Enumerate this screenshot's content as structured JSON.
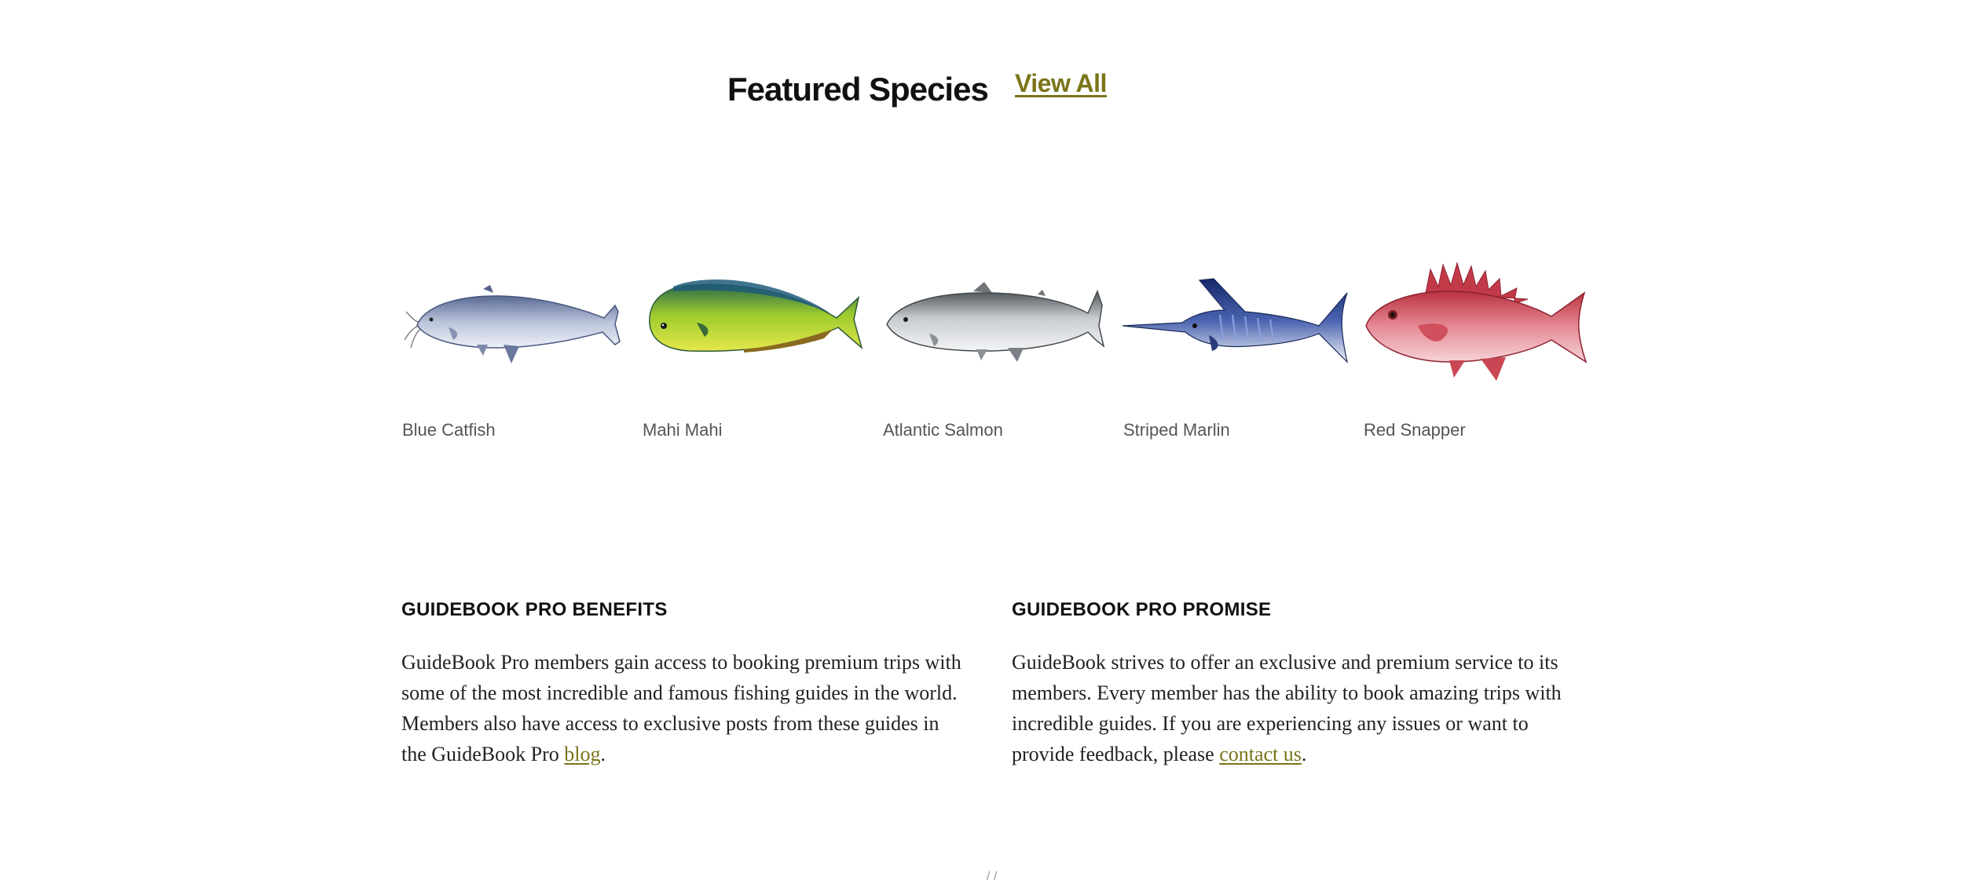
{
  "featured": {
    "title": "Featured Species",
    "view_all_label": "View All"
  },
  "species": [
    {
      "name": "Blue Catfish",
      "icon": "blue-catfish-illustration"
    },
    {
      "name": "Mahi Mahi",
      "icon": "mahi-mahi-illustration"
    },
    {
      "name": "Atlantic Salmon",
      "icon": "atlantic-salmon-illustration"
    },
    {
      "name": "Striped Marlin",
      "icon": "striped-marlin-illustration"
    },
    {
      "name": "Red Snapper",
      "icon": "red-snapper-illustration"
    }
  ],
  "benefits": {
    "heading": "GUIDEBOOK PRO BENEFITS",
    "text_before_link": "GuideBook Pro members gain access to booking premium trips with some of the most incredible and famous fishing guides in the world. Members also have access to exclusive posts from these guides in the GuideBook Pro ",
    "link_label": "blog",
    "text_after_link": "."
  },
  "promise": {
    "heading": "GUIDEBOOK PRO PROMISE",
    "text_before_link": "GuideBook strives to offer an exclusive and premium service to its members. Every member has the ability to book amazing trips with incredible guides. If you are experiencing any issues or want to provide feedback, please ",
    "link_label": "contact us",
    "text_after_link": "."
  },
  "footer_mark": "/ /",
  "colors": {
    "accent_link": "#7a7418",
    "heading_text": "#111111",
    "caption_text": "#555555"
  }
}
